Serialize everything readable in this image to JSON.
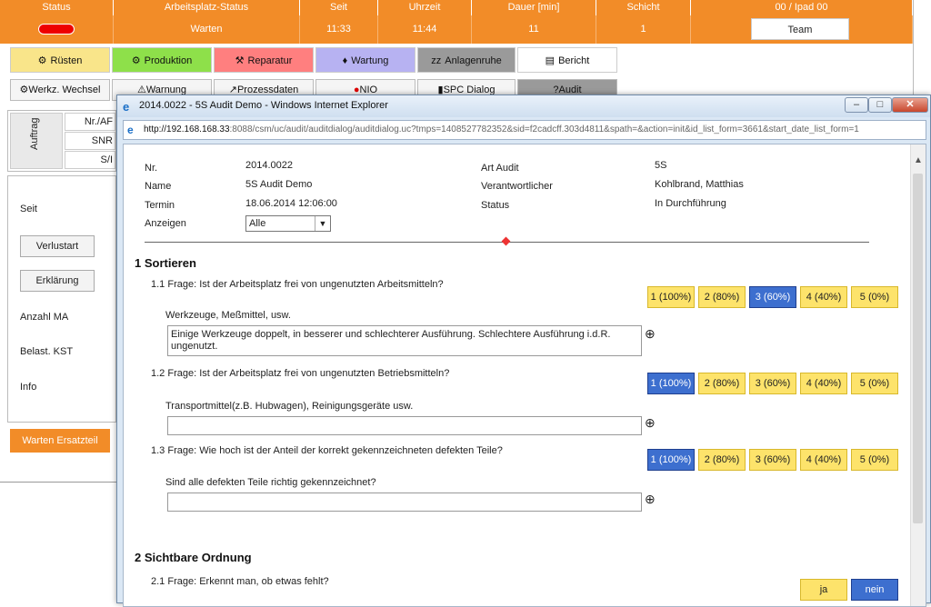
{
  "header": {
    "cols": [
      "Status",
      "Arbeitsplatz-Status",
      "Seit",
      "Uhrzeit",
      "Dauer [min]",
      "Schicht",
      "00  / Ipad 00"
    ],
    "values": {
      "arbeitsplatz_status": "Warten",
      "seit": "11:33",
      "uhrzeit": "11:44",
      "dauer": "11",
      "schicht": "1"
    },
    "team_button": "Team",
    "status_color": "#e60000"
  },
  "toolbar": {
    "row1": [
      {
        "label": "Rüsten",
        "icon": "ruesten-icon",
        "color": "#f9e58a"
      },
      {
        "label": "Produktion",
        "icon": "gear-icon",
        "color": "#8ee04a"
      },
      {
        "label": "Reparatur",
        "icon": "tools-icon",
        "color": "#ff7f7f"
      },
      {
        "label": "Wartung",
        "icon": "oilcan-icon",
        "color": "#b7b2f2"
      },
      {
        "label": "Anlagenruhe",
        "icon": "sleep-icon",
        "color": "#9a9a9a"
      },
      {
        "label": "Bericht",
        "icon": "report-icon",
        "color": "#ffffff"
      }
    ],
    "row2": [
      {
        "label": "Werkz. Wechsel",
        "icon": "tool-change-icon"
      },
      {
        "label": "Warnung",
        "icon": "warning-icon"
      },
      {
        "label": "Prozessdaten",
        "icon": "chart-icon"
      },
      {
        "label": "NIO",
        "icon": "nio-icon"
      },
      {
        "label": "SPC Dialog",
        "icon": "spc-icon"
      },
      {
        "label": "Audit",
        "icon": "audit-icon"
      }
    ]
  },
  "left_panel": {
    "auftrag_label": "Auftrag",
    "auftrag_fields": [
      "Nr./AF",
      "SNR",
      "S/I"
    ],
    "seit_label": "Seit",
    "verlustart_button": "Verlustart",
    "erklaerung_button": "Erklärung",
    "anzahl_ma_label": "Anzahl MA",
    "belast_kst_label": "Belast. KST",
    "info_label": "Info",
    "warten_ersatzteil": "Warten Ersatzteil"
  },
  "window": {
    "title": "2014.0022 - 5S Audit Demo - Windows Internet Explorer",
    "url_host": "http://192.168.168.33",
    "url_rest": ":8088/csm/uc/audit/auditdialog/auditdialog.uc?tmps=1408527782352&sid=f2cadcff.303d4811&spath=&action=init&id_list_form=3661&start_date_list_form=1",
    "minimize": "–",
    "maximize": "□",
    "close": "✕"
  },
  "audit": {
    "nr_label": "Nr.",
    "nr": "2014.0022",
    "name_label": "Name",
    "name": "5S Audit Demo",
    "termin_label": "Termin",
    "termin": "18.06.2014 12:06:00",
    "anzeigen_label": "Anzeigen",
    "anzeigen": "Alle",
    "art_label": "Art Audit",
    "art": "5S",
    "verantw_label": "Verantwortlicher",
    "verantw": "Kohlbrand, Matthias",
    "status_label": "Status",
    "status": "In Durchführung"
  },
  "sections": [
    {
      "title": "1   Sortieren",
      "questions": [
        {
          "text": "1.1 Frage: Ist der Arbeitsplatz frei von ungenutzten Arbeitsmitteln?",
          "hint": "Werkzeuge, Meßmittel, usw.",
          "comment": "Einige Werkzeuge doppelt, in besserer und schlechterer Ausführung. Schlechtere Ausführung i.d.R. ungenutzt.",
          "selected": 2
        },
        {
          "text": "1.2 Frage: Ist der Arbeitsplatz frei von ungenutzten Betriebsmitteln?",
          "hint": "Transportmittel(z.B. Hubwagen), Reinigungsgeräte usw.",
          "comment": "",
          "selected": 0
        },
        {
          "text": "1.3 Frage: Wie hoch ist der Anteil der korrekt gekennzeichneten defekten Teile?",
          "hint": "Sind alle defekten Teile richtig gekennzeichnet?",
          "comment": "",
          "selected": 0
        }
      ]
    },
    {
      "title": "2   Sichtbare Ordnung",
      "questions": [
        {
          "text": "2.1 Frage: Erkennt man, ob etwas fehlt?",
          "yes": "ja",
          "no": "nein",
          "selected": "nein"
        }
      ]
    }
  ],
  "ratings": [
    "1 (100%)",
    "2 (80%)",
    "3 (60%)",
    "4 (40%)",
    "5 (0%)"
  ],
  "colors": {
    "orange": "#f28c28",
    "rating_yellow": "#fde36b",
    "rating_selected": "#3d6fcf"
  }
}
